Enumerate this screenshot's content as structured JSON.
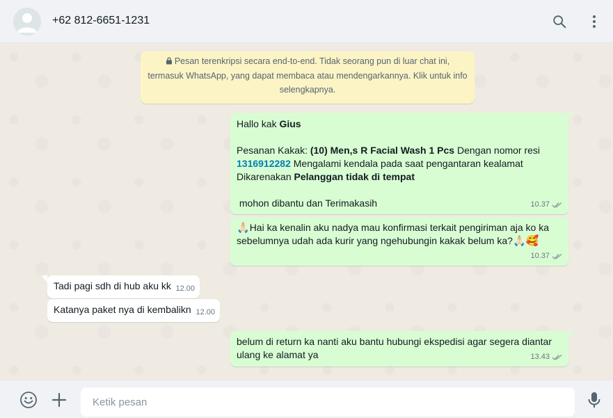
{
  "header": {
    "contact_name": "+62 812-6651-1231",
    "icons": [
      "search-icon",
      "menu-icon"
    ]
  },
  "encryption_notice": {
    "line1": "Pesan terenkripsi secara end-to-end. Tidak seorang pun di luar chat ini,",
    "line2": "termasuk WhatsApp, yang dapat membaca atau mendengarkannya. Klik untuk info",
    "line3": "selengkapnya."
  },
  "messages": [
    {
      "direction": "out",
      "greeting_prefix": "Hallo kak ",
      "greeting_name": "Gius",
      "order_prefix": "Pesanan Kakak: ",
      "order_item": "(10) Men,s R Facial Wash 1 Pcs",
      "order_mid": " Dengan nomor resi",
      "tracking_number": "1316912282",
      "order_suffix": " Mengalami kendala pada saat pengantaran kealamat",
      "reason_prefix": "Dikarenakan ",
      "reason": "Pelanggan tidak di tempat",
      "closing": " mohon dibantu dan Terimakasih",
      "time": "10.37"
    },
    {
      "direction": "out",
      "emoji_start": "🙏🏻",
      "text": "Hai ka kenalin aku nadya mau konfirmasi terkait pengiriman aja ko ka sebelumnya udah ada kurir yang ngehubungin kakak belum ka?",
      "emoji_end": "🙏🏻🥰",
      "time": "10.37"
    },
    {
      "direction": "in",
      "text": "Tadi pagi sdh di hub aku kk",
      "time": "12.00"
    },
    {
      "direction": "in",
      "text": "Katanya paket nya di kembalikn",
      "time": "12.00"
    },
    {
      "direction": "out",
      "text": "belum di return ka nanti aku bantu hubungi ekspedisi agar segera diantar ulang ke alamat ya",
      "time": "13.43"
    }
  ],
  "footer": {
    "input_placeholder": "Ketik pesan",
    "icons": [
      "emoji-icon",
      "attach-plus-icon",
      "microphone-icon"
    ]
  },
  "colors": {
    "outgoing_bubble": "#d9fdd3",
    "incoming_bubble": "#ffffff",
    "chat_background": "#efeae2",
    "header_background": "#f0f2f5",
    "encryption_notice": "#fdf4c5",
    "link": "#027eb5",
    "read_ticks": "#8696a0"
  }
}
